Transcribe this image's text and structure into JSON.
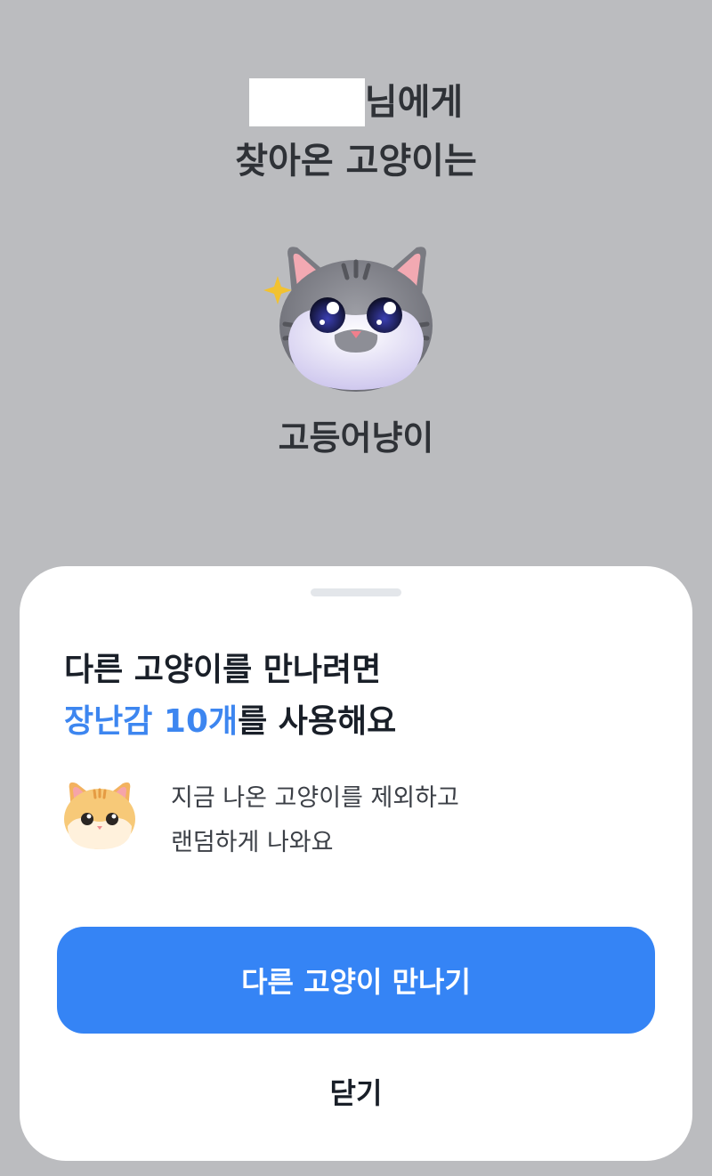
{
  "header": {
    "title_suffix": "님에게",
    "title_line2": "찾아온 고양이는"
  },
  "result": {
    "cat_name": "고등어냥이",
    "icon": "mackerel-tabby-cat-face-with-sparkles"
  },
  "sheet": {
    "title_line1": "다른 고양이를 만나려면",
    "title_accent": "장난감 10개",
    "title_line2_rest": "를 사용해요",
    "info_icon": "orange-cat-face",
    "info_line1": "지금 나온 고양이를 제외하고",
    "info_line2": "랜덤하게 나와요",
    "primary_button": "다른 고양이 만나기",
    "close_button": "닫기"
  },
  "colors": {
    "backdrop": "#bbbcbf",
    "accent": "#3d86f0",
    "button": "#3584f5"
  }
}
